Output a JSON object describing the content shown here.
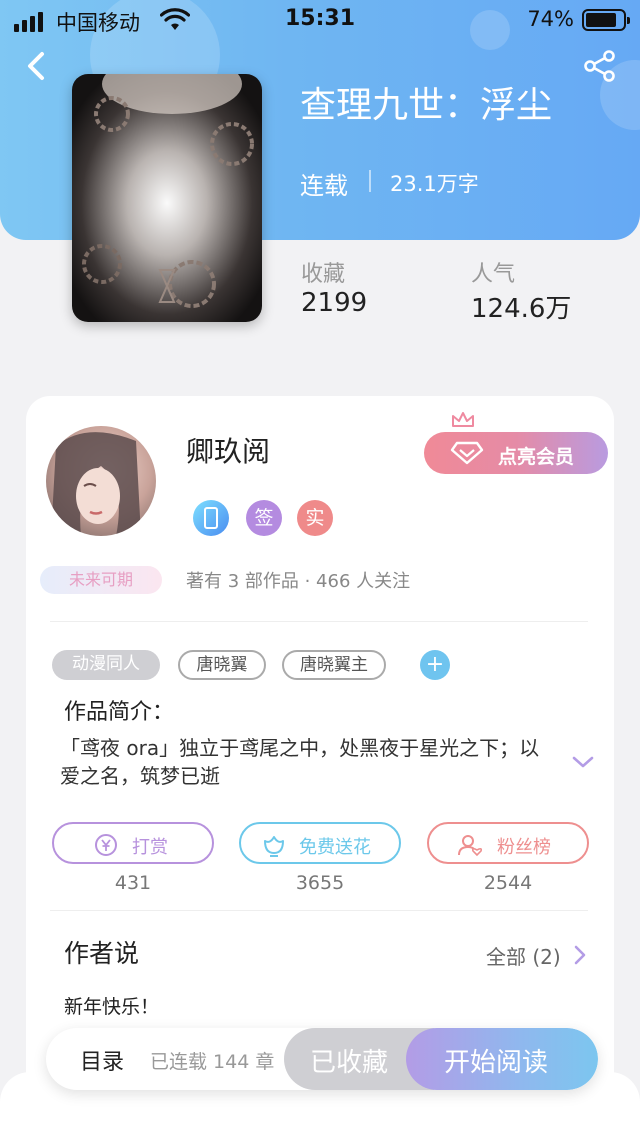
{
  "status_bar": {
    "carrier": "中国移动",
    "time": "15:31",
    "battery": "74%",
    "battery_level": 0.74
  },
  "book": {
    "title": "查理九世：浮尘",
    "status": "连载",
    "word_count": "23.1万字",
    "stats": [
      {
        "label": "收藏",
        "value": "2199"
      },
      {
        "label": "人气",
        "value": "124.6万"
      }
    ]
  },
  "author": {
    "name": "卿玖阅",
    "vip_button": "点亮会员",
    "badges": [
      {
        "text": "",
        "icon": "phone-icon",
        "color": "#4aa8f0"
      },
      {
        "text": "签",
        "color": "#b48be0"
      },
      {
        "text": "实",
        "color": "#ef8a8a"
      }
    ],
    "title_tag": "未来可期",
    "works_info": "著有 3 部作品 · 466 人关注"
  },
  "tags": [
    "动漫同人",
    "唐晓翼",
    "唐晓翼主"
  ],
  "intro": {
    "heading": "作品简介：",
    "text": "「鸢夜 ora」独立于鸢尾之中，处黑夜于星光之下；以爱之名，筑梦已逝"
  },
  "actions": [
    {
      "label": "打赏",
      "count": "431",
      "color": "#b792dd",
      "icon": "yen-coin-icon"
    },
    {
      "label": "免费送花",
      "count": "3655",
      "color": "#6cc8ea",
      "icon": "flower-icon"
    },
    {
      "label": "粉丝榜",
      "count": "2544",
      "color": "#ee8f8f",
      "icon": "fan-user-icon"
    }
  ],
  "author_says": {
    "heading": "作者说",
    "all_link": "全部 (2)",
    "message": "新年快乐！"
  },
  "bottom_bar": {
    "toc": "目录",
    "chapters": "已连载 144 章",
    "favorited": "已收藏",
    "start_reading": "开始阅读"
  },
  "colors": {
    "header_gradient": [
      "#7fc7f3",
      "#66a9f4"
    ],
    "accent_purple": "#b39ce6"
  }
}
